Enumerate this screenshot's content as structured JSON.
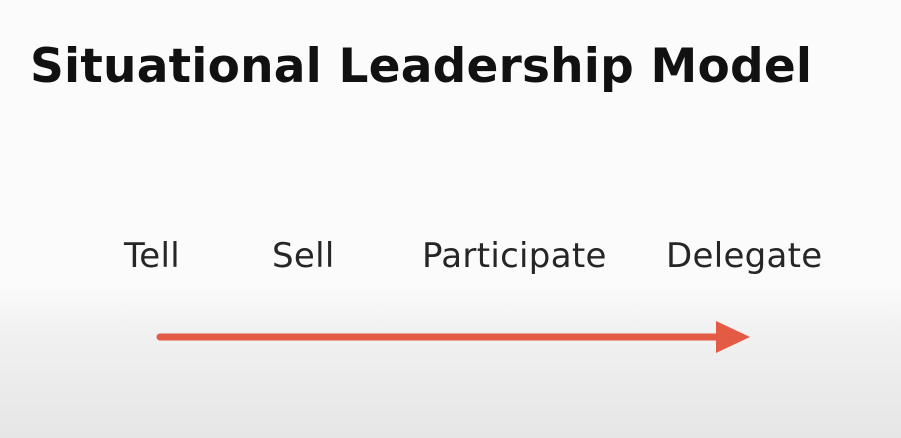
{
  "slide": {
    "title": "Situational Leadership Model",
    "stages": [
      "Tell",
      "Sell",
      "Participate",
      "Delegate"
    ]
  },
  "colors": {
    "title_text": "#111111",
    "stage_text": "#262626",
    "arrow": "#e35b45",
    "background": "#fbfbfb"
  },
  "icons": {
    "arrow": "right-arrow-icon"
  }
}
